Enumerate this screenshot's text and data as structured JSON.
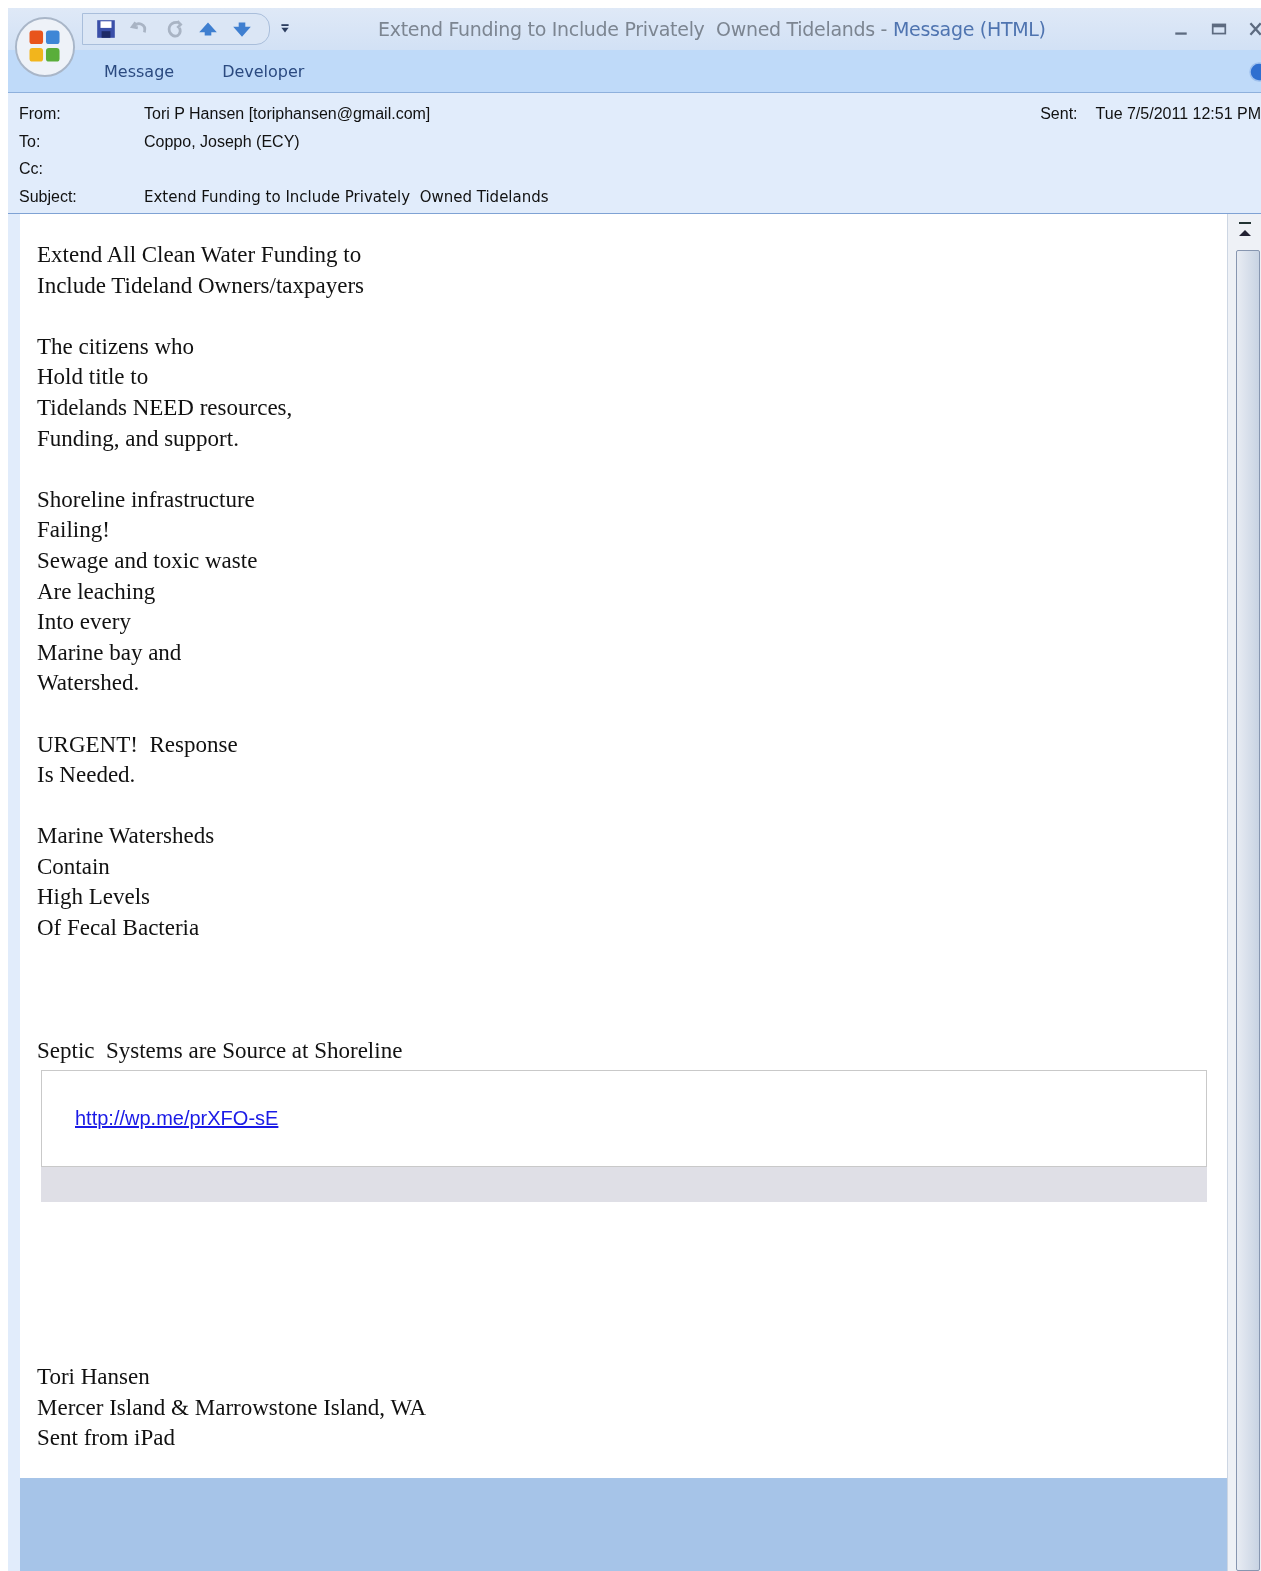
{
  "window": {
    "subject": "Extend Funding to Include Privately  Owned Tidelands",
    "separator": "-",
    "app": "Message (HTML)"
  },
  "tabs": [
    {
      "label": "Message"
    },
    {
      "label": "Developer"
    }
  ],
  "header": {
    "fields": [
      {
        "label": "From:",
        "value": "Tori P Hansen [toriphansen@gmail.com]"
      },
      {
        "label": "To:",
        "value": "Coppo, Joseph (ECY)"
      },
      {
        "label": "Cc:"
      },
      {
        "label": "Subject:",
        "value": "Extend Funding to Include Privately  Owned Tidelands"
      }
    ],
    "sent": {
      "label": "Sent:",
      "value": "Tue 7/5/2011 12:51 PM"
    }
  },
  "body": [
    {
      "kind": "paragraph",
      "lines": [
        "Extend All Clean Water Funding to",
        "Include Tideland Owners/taxpayers"
      ]
    },
    {
      "kind": "paragraph",
      "lines": [
        "The citizens who",
        "Hold title to",
        "Tidelands NEED resources,",
        "Funding, and support."
      ]
    },
    {
      "kind": "paragraph",
      "lines": [
        "Shoreline infrastructure",
        "Failing!",
        "Sewage and toxic waste",
        "Are leaching",
        "Into every",
        "Marine bay and",
        "Watershed."
      ]
    },
    {
      "kind": "paragraph",
      "lines": [
        "URGENT!  Response",
        "Is Needed."
      ]
    },
    {
      "kind": "paragraph",
      "lines": [
        "Marine Watersheds",
        "Contain",
        "High Levels",
        "Of Fecal Bacteria"
      ]
    },
    {
      "kind": "spaced",
      "lines": [
        "Septic  Systems are Source at Shoreline"
      ]
    },
    {
      "kind": "link_box",
      "link": "http://wp.me/prXFO-sE"
    },
    {
      "kind": "signature",
      "lines": [
        "Tori Hansen",
        "Mercer Island & Marrowstone Island, WA",
        "Sent from iPad"
      ]
    }
  ]
}
